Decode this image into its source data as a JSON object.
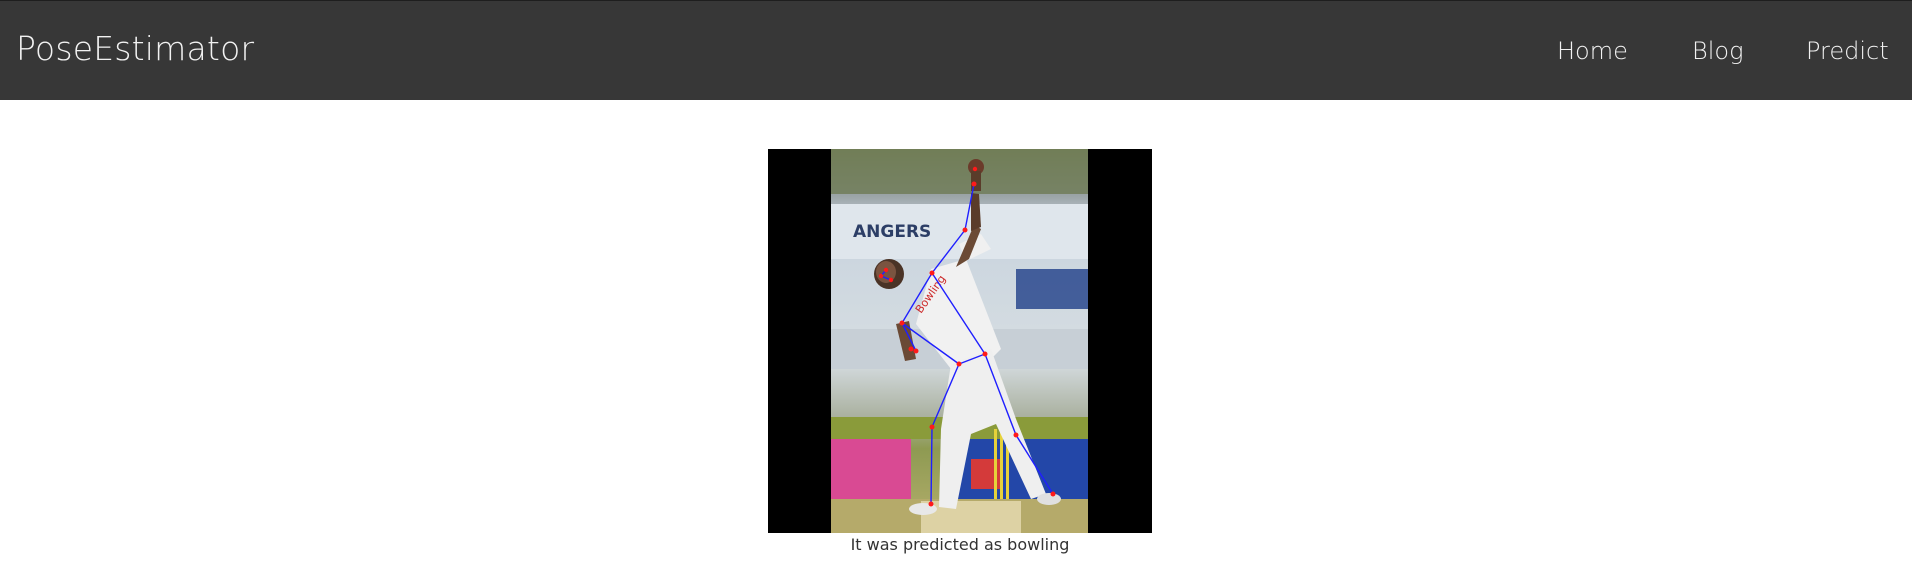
{
  "navbar": {
    "brand": "PoseEstimator",
    "links": [
      {
        "label": "Home"
      },
      {
        "label": "Blog"
      },
      {
        "label": "Predict"
      }
    ]
  },
  "result": {
    "jersey_text": "Bowling",
    "banner_text": "ANGERS",
    "caption": "It was predicted as bowling"
  },
  "colors": {
    "navbar_bg": "#373737",
    "skeleton_line": "#1f1fff",
    "keypoint": "#ff1a1a"
  }
}
